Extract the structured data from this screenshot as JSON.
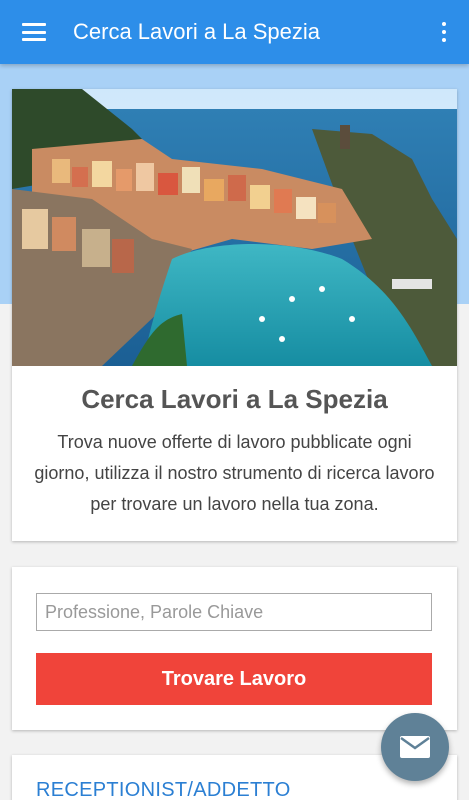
{
  "appbar": {
    "title": "Cerca Lavori a La Spezia",
    "menu_icon": "menu-icon",
    "more_icon": "more-vert-icon",
    "color": "#2d8ee9"
  },
  "hero": {
    "title": "Cerca Lavori a La Spezia",
    "description": "Trova nuove offerte di lavoro pubblicate ogni giorno, utilizza il nostro strumento di ricerca lavoro per trovare un lavoro nella tua zona."
  },
  "search": {
    "placeholder": "Professione, Parole Chiave",
    "value": "",
    "button_label": "Trovare Lavoro",
    "button_color": "#f0443a"
  },
  "jobs": [
    {
      "title": "RECEPTIONIST/ADDETTO"
    }
  ],
  "fab": {
    "icon": "mail-icon"
  }
}
